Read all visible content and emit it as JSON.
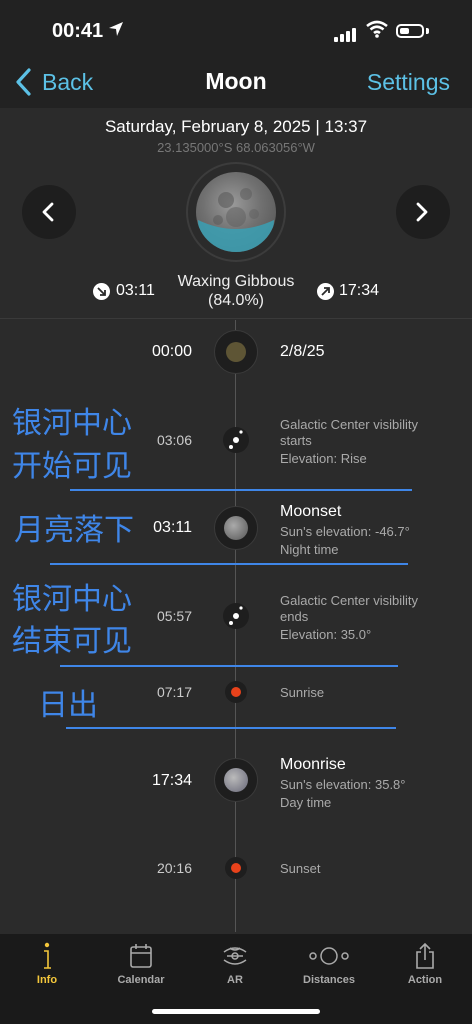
{
  "status": {
    "time": "00:41"
  },
  "nav": {
    "back": "Back",
    "title": "Moon",
    "settings": "Settings"
  },
  "header": {
    "date": "Saturday, February 8, 2025 | 13:37",
    "coords": "23.135000°S 68.063056°W",
    "phase_name": "Waxing Gibbous",
    "phase_pct": "(84.0%)",
    "moonset": "03:11",
    "moonrise": "17:34"
  },
  "timeline": [
    {
      "time": "00:00",
      "title": "2/8/25",
      "sub": []
    },
    {
      "time": "03:06",
      "title": "",
      "sub": [
        "Galactic Center visibility",
        "starts",
        "Elevation: Rise"
      ]
    },
    {
      "time": "03:11",
      "title": "Moonset",
      "sub": [
        "Sun's elevation: -46.7°",
        "Night time"
      ]
    },
    {
      "time": "05:57",
      "title": "",
      "sub": [
        "Galactic Center visibility",
        "ends",
        "Elevation: 35.0°"
      ]
    },
    {
      "time": "07:17",
      "title": "",
      "sub": [
        "Sunrise"
      ]
    },
    {
      "time": "17:34",
      "title": "Moonrise",
      "sub": [
        "Sun's elevation: 35.8°",
        "Day time"
      ]
    },
    {
      "time": "20:16",
      "title": "",
      "sub": [
        "Sunset"
      ]
    }
  ],
  "annotations": {
    "gc_start_1": "银河中心",
    "gc_start_2": "开始可见",
    "moonset": "月亮落下",
    "gc_end_1": "银河中心",
    "gc_end_2": "结束可见",
    "sunrise": "日出"
  },
  "tabs": [
    {
      "label": "Info",
      "icon": "info-icon",
      "active": true
    },
    {
      "label": "Calendar",
      "icon": "calendar-icon",
      "active": false
    },
    {
      "label": "AR",
      "icon": "ar-icon",
      "active": false
    },
    {
      "label": "Distances",
      "icon": "distances-icon",
      "active": false
    },
    {
      "label": "Action",
      "icon": "share-icon",
      "active": false
    }
  ],
  "colors": {
    "accent": "#5cc1e6",
    "active_tab": "#f4c73b",
    "annotation": "#3f86e8",
    "sun_dot": "#e8421b"
  },
  "moon_illumination": 0.84
}
